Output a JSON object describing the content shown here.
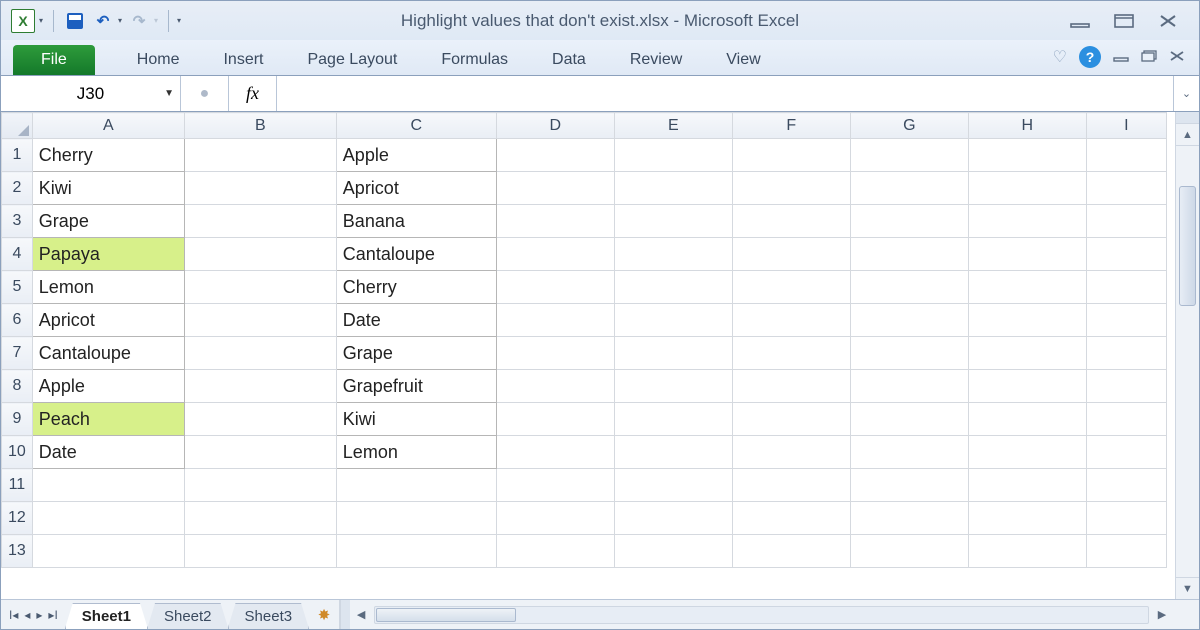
{
  "title": "Highlight values that don't exist.xlsx  -  Microsoft Excel",
  "ribbon": {
    "file": "File",
    "tabs": [
      "Home",
      "Insert",
      "Page Layout",
      "Formulas",
      "Data",
      "Review",
      "View"
    ]
  },
  "namebox": "J30",
  "fx": "fx",
  "formula": "",
  "columns": [
    "A",
    "B",
    "C",
    "D",
    "E",
    "F",
    "G",
    "H",
    "I"
  ],
  "rows": [
    "1",
    "2",
    "3",
    "4",
    "5",
    "6",
    "7",
    "8",
    "9",
    "10",
    "11",
    "12",
    "13"
  ],
  "colA": [
    "Cherry",
    "Kiwi",
    "Grape",
    "Papaya",
    "Lemon",
    "Apricot",
    "Cantaloupe",
    "Apple",
    "Peach",
    "Date"
  ],
  "colC": [
    "Apple",
    "Apricot",
    "Banana",
    "Cantaloupe",
    "Cherry",
    "Date",
    "Grape",
    "Grapefruit",
    "Kiwi",
    "Lemon"
  ],
  "highlightA": [
    4,
    9
  ],
  "sheets": [
    "Sheet1",
    "Sheet2",
    "Sheet3"
  ],
  "activeSheet": 0
}
